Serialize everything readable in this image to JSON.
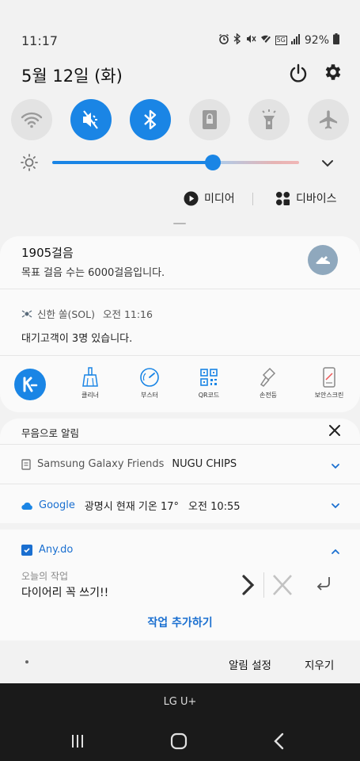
{
  "status_bar": {
    "time": "11:17",
    "battery": "92%",
    "icons": [
      "alarm-icon",
      "bluetooth-icon",
      "mute-icon",
      "wifi-off-icon",
      "5g-icon",
      "signal-icon",
      "battery-icon"
    ],
    "network_label": "5G"
  },
  "header": {
    "date": "5월 12일 (화)"
  },
  "quick_settings": {
    "tiles": [
      {
        "name": "wifi",
        "icon": "wifi-icon",
        "state": "off"
      },
      {
        "name": "sound",
        "icon": "mute-icon",
        "state": "on"
      },
      {
        "name": "bluetooth",
        "icon": "bluetooth-icon",
        "state": "on"
      },
      {
        "name": "rotation-lock",
        "icon": "lock-rotate-icon",
        "state": "off"
      },
      {
        "name": "flashlight",
        "icon": "flashlight-icon",
        "state": "off"
      },
      {
        "name": "airplane",
        "icon": "airplane-icon",
        "state": "off"
      }
    ],
    "brightness_level": 0.65
  },
  "media_row": {
    "media_label": "미디어",
    "devices_label": "디바이스"
  },
  "notifications": {
    "steps": {
      "title": "1905걸음",
      "body": "목표 걸음 수는 6000걸음입니다."
    },
    "sol": {
      "app": "신한 쏠(SOL)",
      "time": "오전 11:16",
      "body": "대기고객이 3명 있습니다."
    },
    "toolbar": [
      {
        "label": "클리너",
        "icon": "broom-icon"
      },
      {
        "label": "부스터",
        "icon": "speedometer-icon"
      },
      {
        "label": "QR코드",
        "icon": "qr-icon"
      },
      {
        "label": "손전등",
        "icon": "flashlight-icon"
      },
      {
        "label": "보안스크린",
        "icon": "phone-lock-icon"
      }
    ],
    "silent": {
      "label": "무음으로 알림",
      "sgf_app": "Samsung Galaxy Friends",
      "sgf_text": "NUGU CHIPS",
      "google_app": "Google",
      "google_text": "광명시 현재 기온 17°",
      "google_time": "오전 10:55"
    },
    "anydo": {
      "app": "Any.do",
      "task_label": "오늘의 작업",
      "task_value": "다이어리 꼭 쓰기!!",
      "add_task": "작업 추가하기"
    }
  },
  "footer": {
    "notif_settings": "알림 설정",
    "clear": "지우기",
    "carrier": "LG U+"
  },
  "colors": {
    "accent": "#1a85e5",
    "link": "#1a6fd0",
    "nav_bg": "#1a1a1a"
  }
}
